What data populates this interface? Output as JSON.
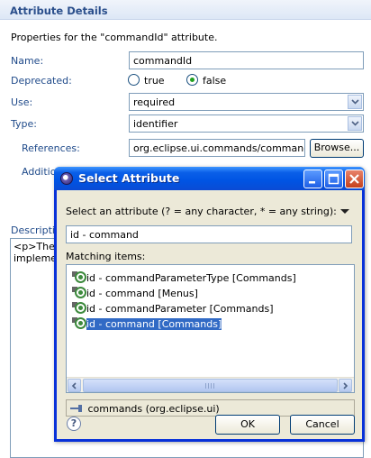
{
  "section": {
    "title": "Attribute Details",
    "description": "Properties for the \"commandId\" attribute."
  },
  "form": {
    "name_label": "Name:",
    "name_value": "commandId",
    "deprecated_label": "Deprecated:",
    "deprecated_true": "true",
    "deprecated_false": "false",
    "deprecated_selected": "false",
    "use_label": "Use:",
    "use_value": "required",
    "type_label": "Type:",
    "type_value": "identifier",
    "references_label": "References:",
    "references_value": "org.eclipse.ui.commands/command/@id",
    "browse_label": "Browse...",
    "additional_label": "Additio",
    "description_label": "Descriptio",
    "description_line1": "<p>The i",
    "description_line2": "implemen"
  },
  "dialog": {
    "title": "Select Attribute",
    "prompt": "Select an attribute (? = any character, * = any string):",
    "filter_value": "id - command",
    "matching_label": "Matching items:",
    "items": [
      {
        "label": "id - commandParameterType [Commands]",
        "selected": false
      },
      {
        "label": "id - command [Menus]",
        "selected": false
      },
      {
        "label": "id - commandParameter [Commands]",
        "selected": false
      },
      {
        "label": "id - command [Commands]",
        "selected": true
      }
    ],
    "status_text": "commands (org.eclipse.ui)",
    "ok_label": "OK",
    "cancel_label": "Cancel",
    "help_glyph": "?"
  },
  "colors": {
    "section_title": "#2b4f8c",
    "label_blue": "#1f4a8a",
    "titlebar_blue": "#0054e3",
    "selection": "#316ac5",
    "dialog_face": "#ece9d8"
  }
}
